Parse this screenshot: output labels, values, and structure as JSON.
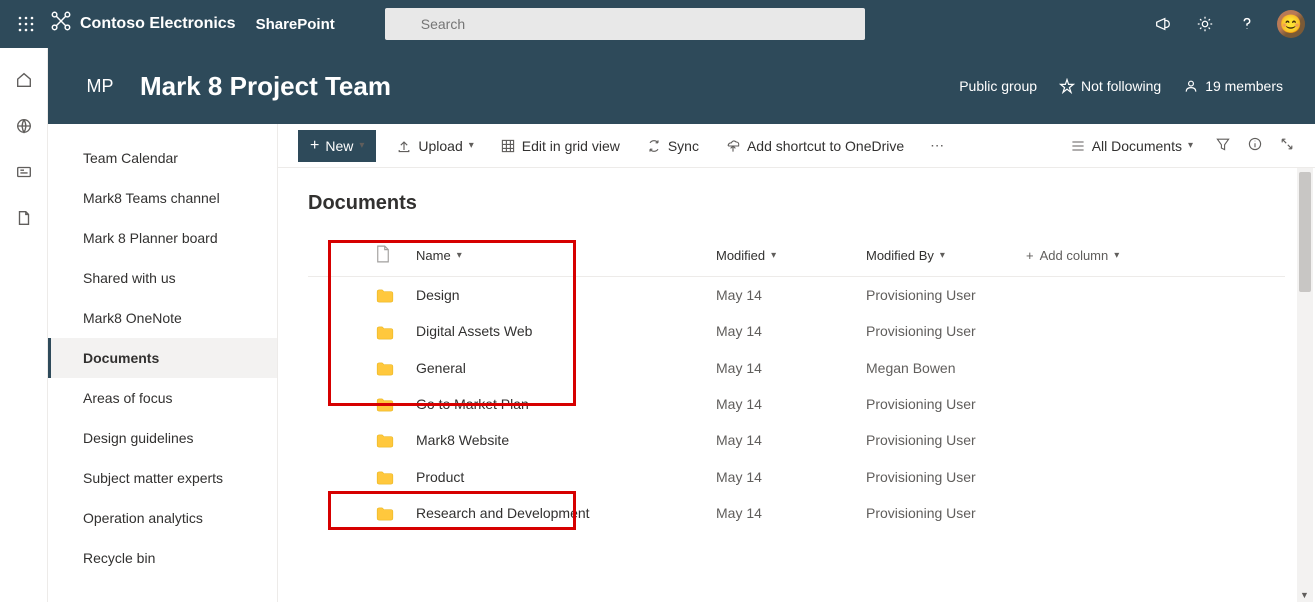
{
  "suite": {
    "org": "Contoso Electronics",
    "app": "SharePoint",
    "search_placeholder": "Search"
  },
  "site": {
    "logo_text": "MP",
    "title": "Mark 8 Project Team",
    "visibility": "Public group",
    "follow": "Not following",
    "members": "19 members"
  },
  "leftnav": {
    "items": [
      "Team Calendar",
      "Mark8 Teams channel",
      "Mark 8 Planner board",
      "Shared with us",
      "Mark8 OneNote",
      "Documents",
      "Areas of focus",
      "Design guidelines",
      "Subject matter experts",
      "Operation analytics",
      "Recycle bin"
    ],
    "selected_index": 5
  },
  "commands": {
    "new": "New",
    "upload": "Upload",
    "editgrid": "Edit in grid view",
    "sync": "Sync",
    "shortcut": "Add shortcut to OneDrive",
    "view": "All Documents"
  },
  "library": {
    "title": "Documents",
    "columns": {
      "name": "Name",
      "modified": "Modified",
      "modifiedby": "Modified By",
      "addcolumn": "Add column"
    },
    "rows": [
      {
        "name": "Design",
        "modified": "May 14",
        "modifiedby": "Provisioning User"
      },
      {
        "name": "Digital Assets Web",
        "modified": "May 14",
        "modifiedby": "Provisioning User"
      },
      {
        "name": "General",
        "modified": "May 14",
        "modifiedby": "Megan Bowen"
      },
      {
        "name": "Go to Market Plan",
        "modified": "May 14",
        "modifiedby": "Provisioning User"
      },
      {
        "name": "Mark8 Website",
        "modified": "May 14",
        "modifiedby": "Provisioning User"
      },
      {
        "name": "Product",
        "modified": "May 14",
        "modifiedby": "Provisioning User"
      },
      {
        "name": "Research and Development",
        "modified": "May 14",
        "modifiedby": "Provisioning User"
      }
    ]
  }
}
